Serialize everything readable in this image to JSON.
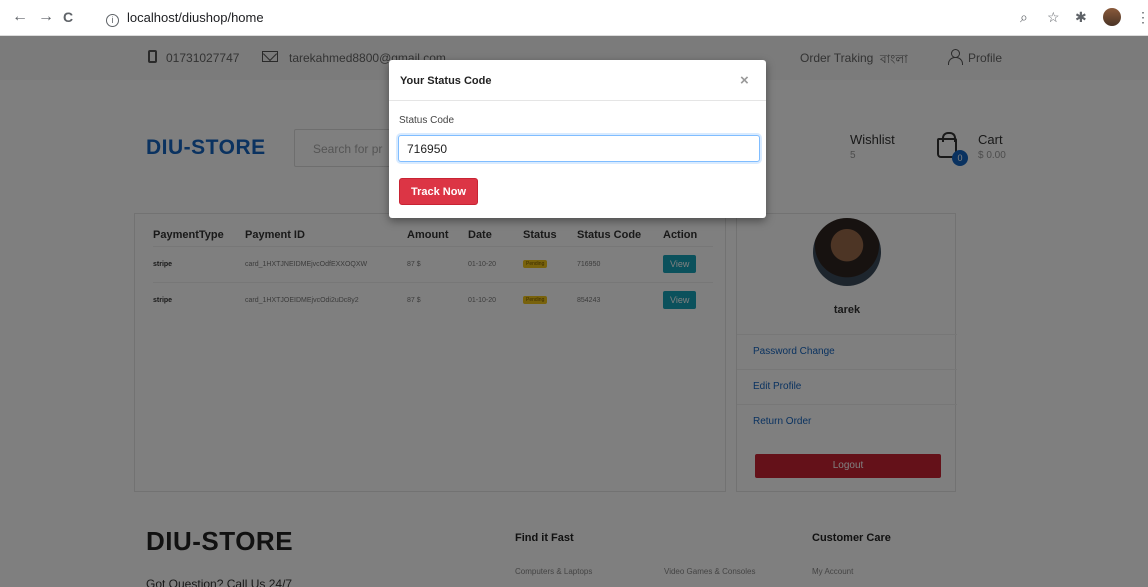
{
  "browser": {
    "url": "localhost/diushop/home",
    "back_glyph": "←",
    "forward_glyph": "→",
    "reload_glyph": "C",
    "info_glyph": "i",
    "zoom_glyph": "⌕",
    "star_glyph": "☆",
    "puzzle_glyph": "✱",
    "menu_glyph": "⋮"
  },
  "topbar": {
    "phone": "01731027747",
    "email": "tarekahmed8800@gmail.com",
    "order_tracking": "Order Traking",
    "language": "বাংলা",
    "profile": "Profile"
  },
  "header": {
    "logo": "DIU-STORE",
    "search_placeholder": "Search for pr",
    "wishlist_label": "Wishlist",
    "wishlist_count": "5",
    "cart_label": "Cart",
    "cart_count": "0",
    "cart_total": "$ 0.00"
  },
  "orders": {
    "columns": [
      "PaymentType",
      "Payment ID",
      "Amount",
      "Date",
      "Status",
      "Status Code",
      "Action"
    ],
    "rows": [
      {
        "payment_type": "stripe",
        "payment_id": "card_1HXTJNEIDMEjvcOdfEXXOQXW",
        "amount": "87 $",
        "date": "01-10-20",
        "status": "Pending",
        "status_code": "716950",
        "action": "View"
      },
      {
        "payment_type": "stripe",
        "payment_id": "card_1HXTJOEIDMEjvcOdi2uDc8y2",
        "amount": "87 $",
        "date": "01-10-20",
        "status": "Pending",
        "status_code": "854243",
        "action": "View"
      }
    ]
  },
  "profile_panel": {
    "name": "tarek",
    "links": [
      "Password Change",
      "Edit Profile",
      "Return Order"
    ],
    "logout": "Logout"
  },
  "footer": {
    "logo": "DIU-STORE",
    "question": "Got Question? Call Us 24/7",
    "find_heading": "Find it Fast",
    "find_link_1": "Computers & Laptops",
    "find_link_2": "Video Games & Consoles",
    "care_heading": "Customer Care",
    "care_link_1": "My Account"
  },
  "modal": {
    "title": "Your Status Code",
    "close_glyph": "×",
    "field_label": "Status Code",
    "field_value": "716950",
    "button": "Track Now"
  }
}
